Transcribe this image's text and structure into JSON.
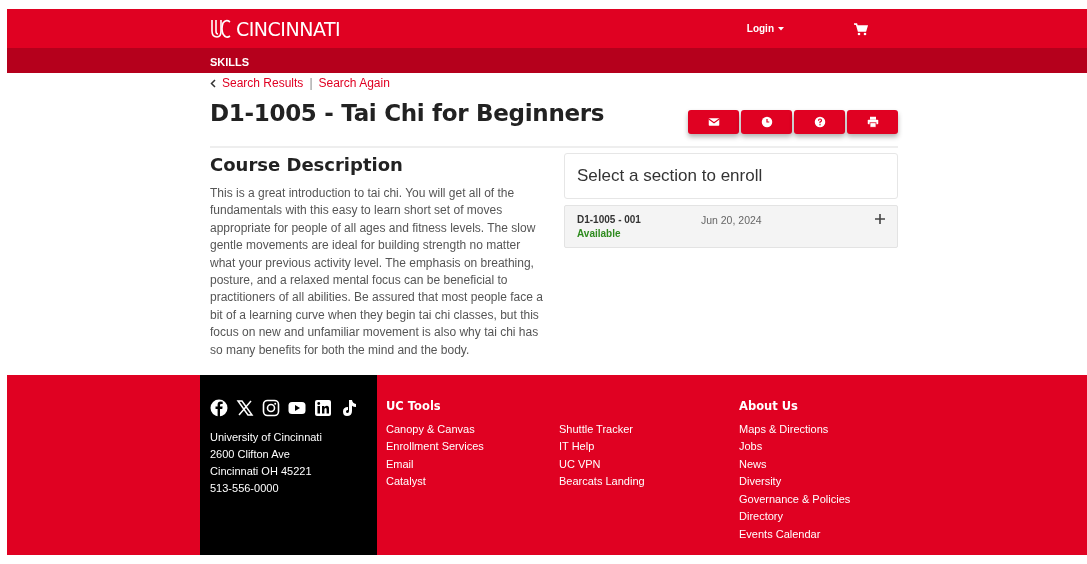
{
  "header": {
    "brand": "CINCINNATI",
    "login": "Login"
  },
  "nav_bar": {
    "label": "SKILLS"
  },
  "breadcrumbs": [
    "Search Results",
    "Search Again"
  ],
  "breadcrumb_separator": "|",
  "title": "D1-1005 - Tai Chi for Beginners",
  "action_buttons": [
    {
      "kind": "email"
    },
    {
      "kind": "clock"
    },
    {
      "kind": "help"
    },
    {
      "kind": "print"
    }
  ],
  "description": {
    "heading": "Course Description",
    "text": "This is a great introduction to tai chi. You will get all of the fundamentals with this easy to learn short set of moves appropriate for people of all ages and fitness levels. The slow gentle movements are ideal for building strength no matter what your previous activity level. The emphasis on breathing, posture, and a relaxed mental focus can be beneficial to practitioners of all abilities. Be assured that most people face a bit of a learning curve when they begin tai chi classes, but this focus on new and unfamiliar movement is also why tai chi has so many benefits for both the mind and the body."
  },
  "enroll": {
    "heading": "Select a section to enroll",
    "sections": [
      {
        "code": "D1-1005 - 001",
        "status": "Available",
        "date": "Jun 20, 2024",
        "expanded": false
      }
    ]
  },
  "footer": {
    "social": [
      {
        "kind": "facebook"
      },
      {
        "kind": "x"
      },
      {
        "kind": "instagram"
      },
      {
        "kind": "youtube"
      },
      {
        "kind": "linkedin"
      },
      {
        "kind": "tiktok"
      }
    ],
    "address": [
      "University of Cincinnati",
      "2600 Clifton Ave",
      "Cincinnati OH 45221",
      "513-556-0000"
    ],
    "columns": [
      {
        "heading": "UC Tools",
        "links": [
          "Canopy & Canvas",
          "Enrollment Services",
          "Email",
          "Catalyst"
        ]
      },
      {
        "links": [
          "Shuttle Tracker",
          "IT Help",
          "UC VPN",
          "Bearcats Landing"
        ]
      },
      {
        "heading": "About Us",
        "links": [
          "Maps & Directions",
          "Jobs",
          "News",
          "Diversity",
          "Governance & Policies",
          "Directory",
          "Events Calendar"
        ]
      }
    ]
  }
}
